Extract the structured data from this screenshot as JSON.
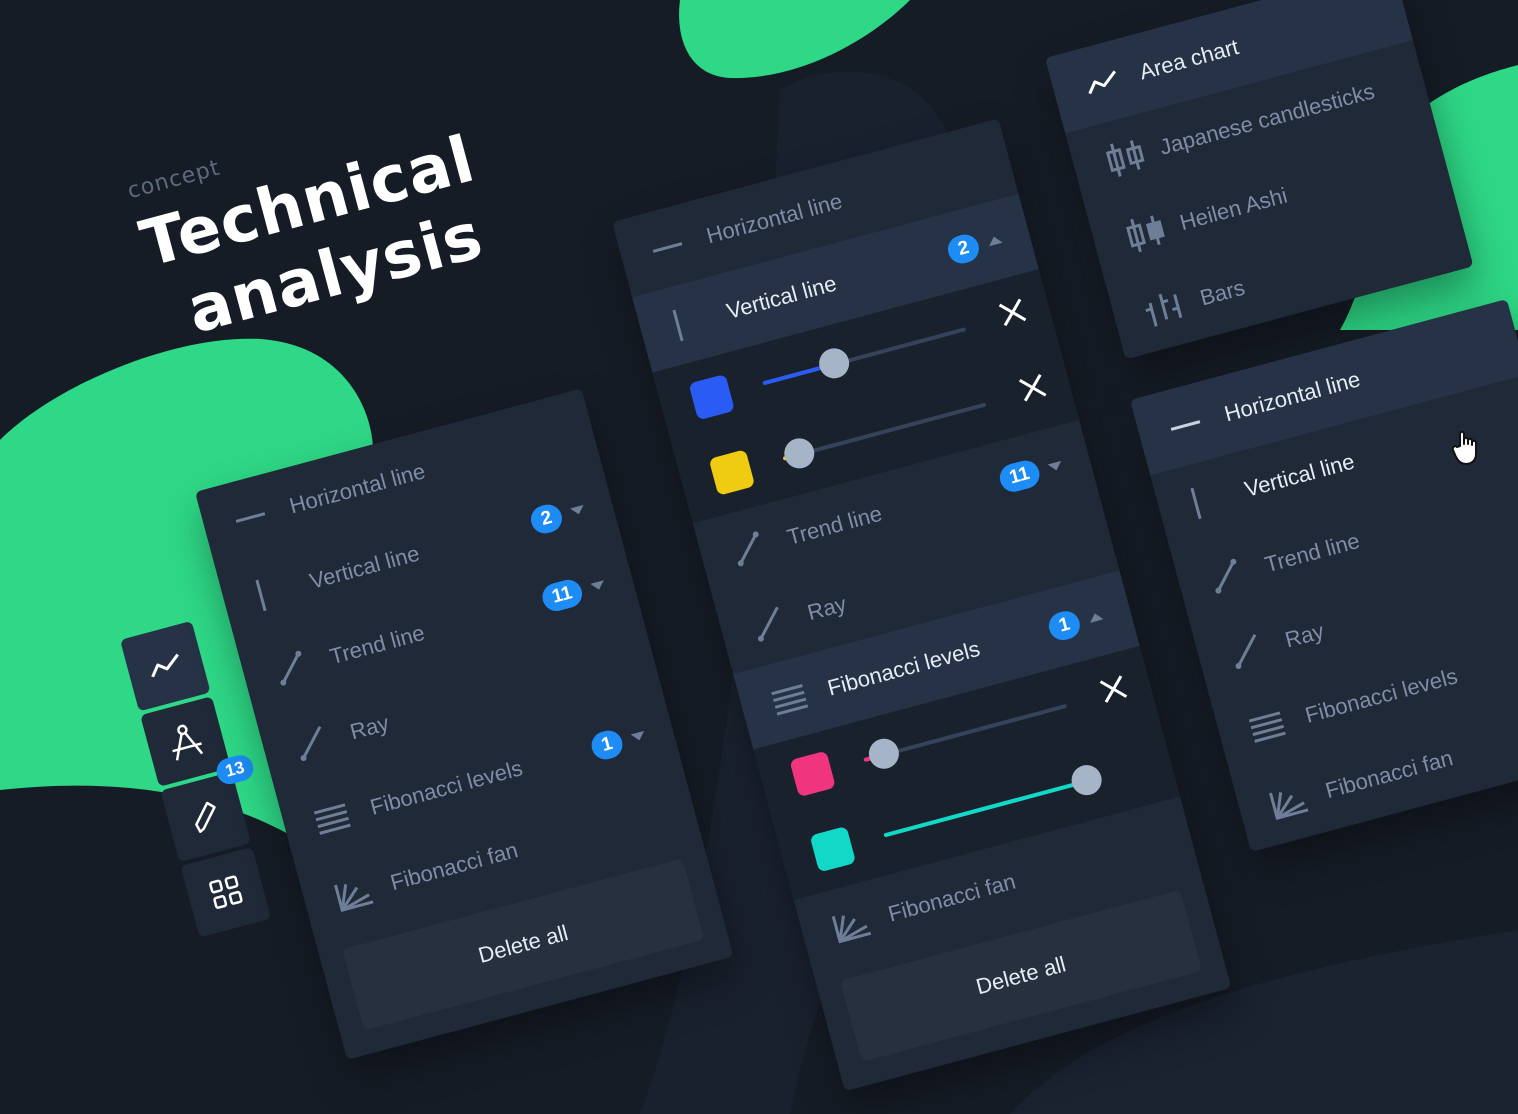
{
  "heading": {
    "concept": "concept",
    "title_line1": "Technical",
    "title_line2": "analysis"
  },
  "colors": {
    "green": "#2ed886",
    "bg": "#161c26",
    "panel": "#1f2938",
    "badge": "#1e8cf5",
    "swatch_blue": "#2a5cf5",
    "swatch_yellow": "#efcc12",
    "swatch_pink": "#f0357f",
    "swatch_cyan": "#12d8c8"
  },
  "toolbar": {
    "items": [
      {
        "icon": "line-chart-icon"
      },
      {
        "icon": "compass-icon"
      },
      {
        "icon": "pencil-icon",
        "badge": "13"
      },
      {
        "icon": "grid-icon"
      }
    ]
  },
  "panel_left": {
    "items": [
      {
        "label": "Horizontal line",
        "icon": "horizontal-line-icon"
      },
      {
        "label": "Vertical line",
        "icon": "vertical-line-icon",
        "badge": "2"
      },
      {
        "label": "Trend line",
        "icon": "trend-line-icon",
        "badge": "11"
      },
      {
        "label": "Ray",
        "icon": "ray-icon"
      },
      {
        "label": "Fibonacci levels",
        "icon": "fibonacci-levels-icon",
        "badge": "1"
      },
      {
        "label": "Fibonacci fan",
        "icon": "fibonacci-fan-icon"
      }
    ],
    "delete_label": "Delete all"
  },
  "panel_mid": {
    "horizontal": "Horizontal line",
    "vertical": "Vertical line",
    "vertical_badge": "2",
    "sliders_top": [
      {
        "color": "#2a5cf5",
        "value": 0.35
      },
      {
        "color": "#efcc12",
        "value": 0.08
      }
    ],
    "trend": "Trend line",
    "trend_badge": "11",
    "ray": "Ray",
    "fib_levels": "Fibonacci levels",
    "fib_badge": "1",
    "sliders_bottom": [
      {
        "color": "#f0357f",
        "value": 0.1
      },
      {
        "color": "#12d8c8",
        "value": 1.0
      }
    ],
    "fib_fan": "Fibonacci fan",
    "delete_label": "Delete all"
  },
  "panel_chart": {
    "items": [
      {
        "label": "Area chart",
        "icon": "area-chart-icon"
      },
      {
        "label": "Japanese candlesticks",
        "icon": "candlesticks-icon"
      },
      {
        "label": "Heilen Ashi",
        "icon": "heikin-ashi-icon"
      },
      {
        "label": "Bars",
        "icon": "bars-icon"
      }
    ]
  },
  "panel_right": {
    "items": [
      {
        "label": "Horizontal line",
        "icon": "horizontal-line-icon"
      },
      {
        "label": "Vertical line",
        "icon": "vertical-line-icon"
      },
      {
        "label": "Trend line",
        "icon": "trend-line-icon"
      },
      {
        "label": "Ray",
        "icon": "ray-icon"
      },
      {
        "label": "Fibonacci levels",
        "icon": "fibonacci-levels-icon"
      },
      {
        "label": "Fibonacci fan",
        "icon": "fibonacci-fan-icon"
      }
    ]
  }
}
